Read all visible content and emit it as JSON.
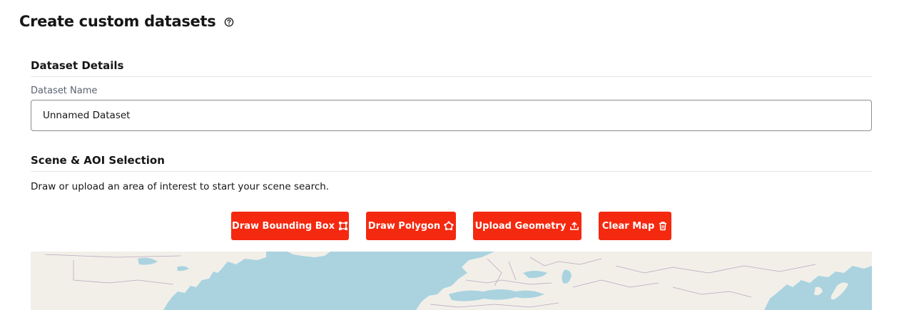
{
  "header": {
    "title": "Create custom datasets",
    "help_icon": "question-circle-icon"
  },
  "dataset_details": {
    "heading": "Dataset Details",
    "name_label": "Dataset Name",
    "name_value": "Unnamed Dataset"
  },
  "scene_selection": {
    "heading": "Scene & AOI Selection",
    "description": "Draw or upload an area of interest to start your scene search."
  },
  "toolbar": {
    "buttons": [
      {
        "label": "Draw Bounding Box",
        "icon": "bounding-box-icon"
      },
      {
        "label": "Draw Polygon",
        "icon": "polygon-icon"
      },
      {
        "label": "Upload Geometry",
        "icon": "upload-icon"
      },
      {
        "label": "Clear Map",
        "icon": "trash-icon"
      }
    ]
  },
  "colors": {
    "accent": "#f5290f",
    "water": "#aad3df",
    "land": "#f2efe9",
    "border": "#b9a8bf"
  }
}
